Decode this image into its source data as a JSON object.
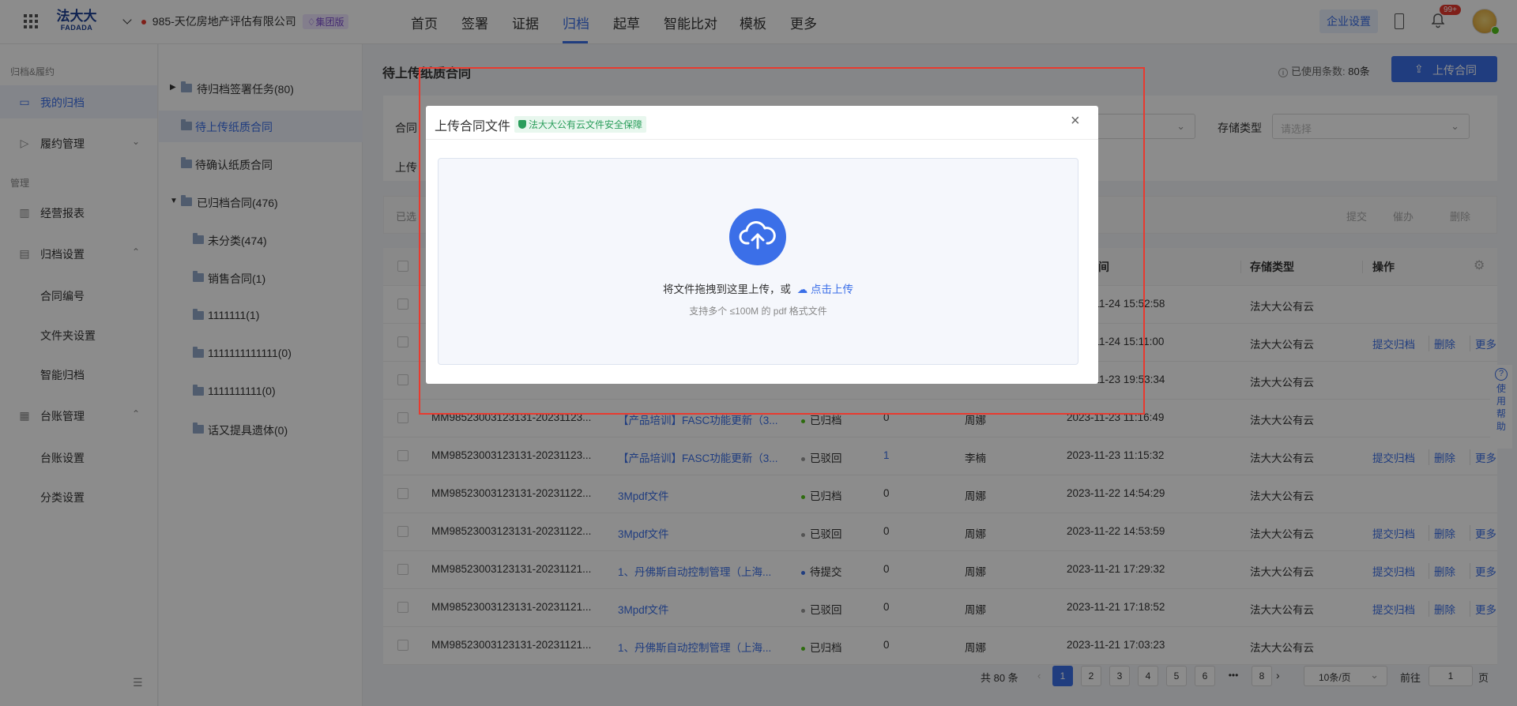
{
  "header": {
    "logo_cn": "法大大",
    "logo_en": "FADADA",
    "company": "985-天亿房地产评估有限公司",
    "company_badge": "集团版",
    "nav": [
      "首页",
      "签署",
      "证据",
      "归档",
      "起草",
      "智能比对",
      "模板",
      "更多"
    ],
    "active_nav": "归档",
    "enterprise_settings": "企业设置",
    "notification_count": "99+"
  },
  "sidebar": {
    "group1": "归档&履约",
    "group2": "管理",
    "items": [
      {
        "label": "我的归档",
        "icon": "archive-icon"
      },
      {
        "label": "履约管理",
        "icon": "contract-icon"
      },
      {
        "label": "经营报表",
        "icon": "chart-icon"
      },
      {
        "label": "归档设置",
        "icon": "archive-settings-icon"
      },
      {
        "label": "合同编号"
      },
      {
        "label": "文件夹设置"
      },
      {
        "label": "智能归档"
      },
      {
        "label": "台账管理",
        "icon": "ledger-icon"
      },
      {
        "label": "台账设置"
      },
      {
        "label": "分类设置"
      }
    ]
  },
  "tree": {
    "items": [
      "待归档签署任务(80)",
      "待上传纸质合同",
      "待确认纸质合同",
      "已归档合同(476)",
      "未分类(474)",
      "销售合同(1)",
      "1111111(1)",
      "1111111111111(0)",
      "1111111111(0)",
      "话又提具遗体(0)"
    ]
  },
  "main": {
    "title": "待上传纸质合同",
    "usage_label": "已使用条数:",
    "usage_value": "80条",
    "upload_button": "上传合同",
    "filter_contract_label": "合同",
    "filter_upload_label": "上传",
    "storage_type_label": "存储类型",
    "storage_type_placeholder": "请选择",
    "selected_label": "已选",
    "bulk_actions": [
      "提交",
      "催办",
      "删除"
    ],
    "columns": {
      "time": "间",
      "storage": "存储类型",
      "actions": "操作"
    },
    "help_label": "使用帮助"
  },
  "table": {
    "rows": [
      {
        "id": "",
        "name": "",
        "status": "",
        "status_color": "",
        "count": "",
        "user": "",
        "time": "2023-11-24 15:52:58",
        "storage": "法大大公有云",
        "actions": []
      },
      {
        "id": "",
        "name": "",
        "status": "",
        "status_color": "",
        "count": "",
        "user": "",
        "time": "2023-11-24 15:11:00",
        "storage": "法大大公有云",
        "actions": [
          "提交归档",
          "删除",
          "更多"
        ]
      },
      {
        "id": "",
        "name": "",
        "status": "",
        "status_color": "",
        "count": "",
        "user": "",
        "time": "2023-11-23 19:53:34",
        "storage": "法大大公有云",
        "actions": []
      },
      {
        "id": "MM98523003123131-20231123...",
        "name": "【产品培训】FASC功能更新（3...",
        "status": "已归档",
        "status_color": "#52c41a",
        "count": "0",
        "user": "周娜",
        "time": "2023-11-23 11:16:49",
        "storage": "法大大公有云",
        "actions": []
      },
      {
        "id": "MM98523003123131-20231123...",
        "name": "【产品培训】FASC功能更新（3...",
        "status": "已驳回",
        "status_color": "#999999",
        "count": "1",
        "user": "李楠",
        "time": "2023-11-23 11:15:32",
        "storage": "法大大公有云",
        "actions": [
          "提交归档",
          "删除",
          "更多"
        ]
      },
      {
        "id": "MM98523003123131-20231122...",
        "name": "3Mpdf文件",
        "status": "已归档",
        "status_color": "#52c41a",
        "count": "0",
        "user": "周娜",
        "time": "2023-11-22 14:54:29",
        "storage": "法大大公有云",
        "actions": []
      },
      {
        "id": "MM98523003123131-20231122...",
        "name": "3Mpdf文件",
        "status": "已驳回",
        "status_color": "#999999",
        "count": "0",
        "user": "周娜",
        "time": "2023-11-22 14:53:59",
        "storage": "法大大公有云",
        "actions": [
          "提交归档",
          "删除",
          "更多"
        ]
      },
      {
        "id": "MM98523003123131-20231121...",
        "name": "1、丹佛斯自动控制管理（上海...",
        "status": "待提交",
        "status_color": "#3b6fe8",
        "count": "0",
        "user": "周娜",
        "time": "2023-11-21 17:29:32",
        "storage": "法大大公有云",
        "actions": [
          "提交归档",
          "删除",
          "更多"
        ]
      },
      {
        "id": "MM98523003123131-20231121...",
        "name": "3Mpdf文件",
        "status": "已驳回",
        "status_color": "#999999",
        "count": "0",
        "user": "周娜",
        "time": "2023-11-21 17:18:52",
        "storage": "法大大公有云",
        "actions": [
          "提交归档",
          "删除",
          "更多"
        ]
      },
      {
        "id": "MM98523003123131-20231121...",
        "name": "1、丹佛斯自动控制管理（上海...",
        "status": "已归档",
        "status_color": "#52c41a",
        "count": "0",
        "user": "周娜",
        "time": "2023-11-21 17:03:23",
        "storage": "法大大公有云",
        "actions": []
      }
    ]
  },
  "pagination": {
    "total": "共 80 条",
    "pages": [
      "1",
      "2",
      "3",
      "4",
      "5",
      "6",
      "•••",
      "8"
    ],
    "current": "1",
    "page_size": "10条/页",
    "goto_label": "前往",
    "goto_value": "1",
    "page_suffix": "页"
  },
  "modal": {
    "title": "上传合同文件",
    "security_badge": "法大大公有云文件安全保障",
    "drop_text": "将文件拖拽到这里上传，或",
    "click_upload": "点击上传",
    "hint": "支持多个 ≤100M 的 pdf 格式文件"
  },
  "colors": {
    "accent": "#3b6fe8",
    "highlight": "#e83a2f",
    "success": "#52c41a"
  }
}
